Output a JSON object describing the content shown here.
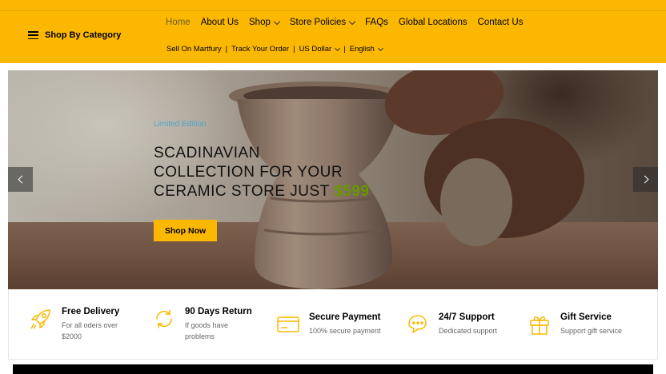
{
  "header": {
    "category_label": "Shop By Category",
    "nav": [
      {
        "label": "Home",
        "active": true,
        "dropdown": false
      },
      {
        "label": "About Us",
        "dropdown": false
      },
      {
        "label": "Shop",
        "dropdown": true
      },
      {
        "label": "Store Policies",
        "dropdown": true
      },
      {
        "label": "FAQs",
        "dropdown": false
      },
      {
        "label": "Global Locations",
        "dropdown": false
      },
      {
        "label": "Contact Us",
        "dropdown": false
      }
    ],
    "subnav": {
      "sell": "Sell On Martfury",
      "track": "Track Your Order",
      "currency": "US Dollar",
      "language": "English"
    },
    "accent_color": "#fcb800"
  },
  "hero": {
    "kicker": "Limited Edition",
    "title_line1": "SCADINAVIAN",
    "title_line2": "COLLECTION FOR YOUR",
    "title_line3": "CERAMIC STORE JUST",
    "price": "$599",
    "cta": "Shop Now",
    "price_color": "#669900"
  },
  "features": [
    {
      "icon": "rocket-icon",
      "title": "Free Delivery",
      "desc1": "For all oders over",
      "desc2": "$2000"
    },
    {
      "icon": "refresh-icon",
      "title": "90 Days Return",
      "desc1": "If goods have",
      "desc2": "problems"
    },
    {
      "icon": "credit-card-icon",
      "title": "Secure Payment",
      "desc1": "100% secure payment",
      "desc2": ""
    },
    {
      "icon": "chat-support-icon",
      "title": "24/7 Support",
      "desc1": "Dedicated support",
      "desc2": ""
    },
    {
      "icon": "gift-icon",
      "title": "Gift Service",
      "desc1": "Support gift service",
      "desc2": ""
    }
  ]
}
